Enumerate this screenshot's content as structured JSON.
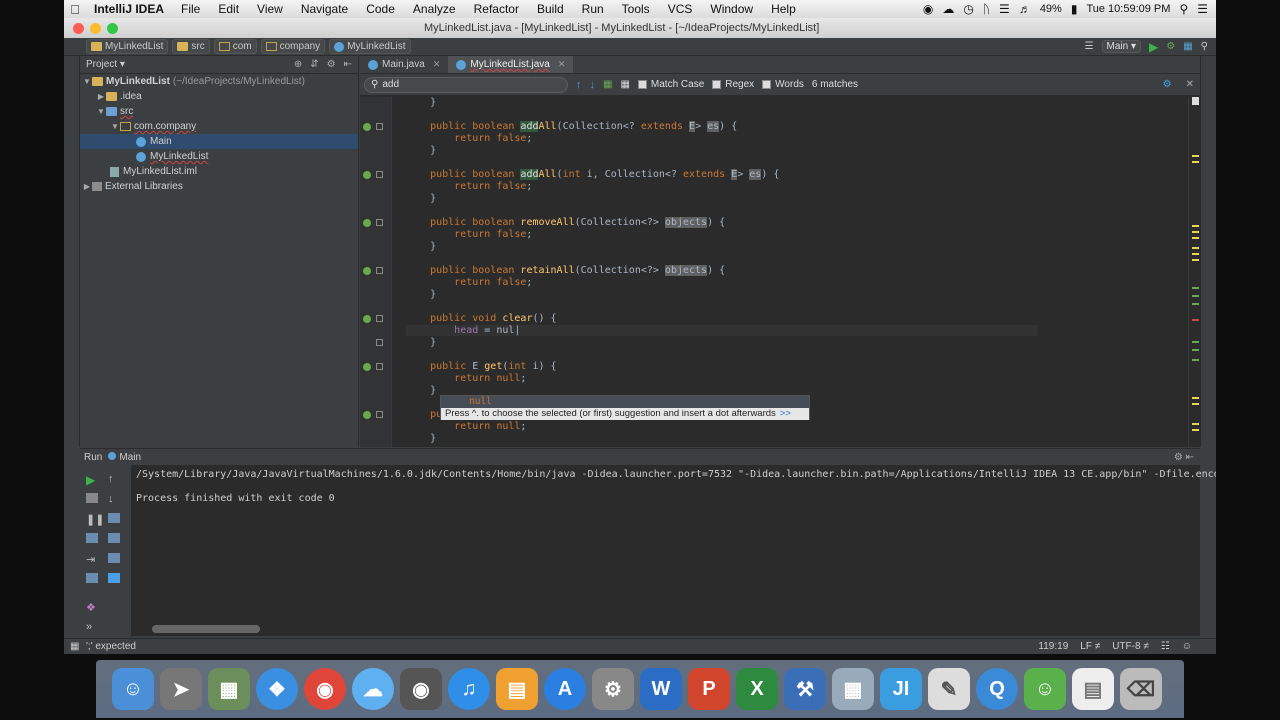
{
  "menubar": {
    "app": "IntelliJ IDEA",
    "items": [
      "File",
      "Edit",
      "View",
      "Navigate",
      "Code",
      "Analyze",
      "Refactor",
      "Build",
      "Run",
      "Tools",
      "VCS",
      "Window",
      "Help"
    ],
    "battery": "49%",
    "clock": "Tue 10:59:09 PM"
  },
  "window": {
    "title": "MyLinkedList.java - [MyLinkedList] - MyLinkedList - [~/IdeaProjects/MyLinkedList]"
  },
  "navbar": {
    "crumbs": [
      "MyLinkedList",
      "src",
      "com",
      "company",
      "MyLinkedList"
    ],
    "run_config": "Main"
  },
  "project": {
    "header": "Project",
    "tree": [
      {
        "label": "MyLinkedList",
        "muted": "(~/IdeaProjects/MyLinkedList)"
      },
      {
        "label": ".idea"
      },
      {
        "label": "src"
      },
      {
        "label": "com.company"
      },
      {
        "label": "Main"
      },
      {
        "label": "MyLinkedList"
      },
      {
        "label": "MyLinkedList.iml"
      },
      {
        "label": "External Libraries"
      }
    ]
  },
  "tabs": [
    "Main.java",
    "MyLinkedList.java"
  ],
  "search": {
    "query": "add",
    "match_case": "Match Case",
    "regex": "Regex",
    "words": "Words",
    "matches": "6 matches"
  },
  "completion": {
    "suggestion": "null",
    "hint": "Press ^. to choose the selected (or first) suggestion and insert a dot afterwards",
    "link": ">>"
  },
  "run": {
    "title": "Run",
    "config": "Main",
    "command": "/System/Library/Java/JavaVirtualMachines/1.6.0.jdk/Contents/Home/bin/java -Didea.launcher.port=7532 \"-Didea.launcher.bin.path=/Applications/IntelliJ IDEA 13 CE.app/bin\" -Dfile.encoding=UTF",
    "result": "Process finished with exit code 0"
  },
  "status": {
    "message": "';' expected",
    "position": "119:19",
    "line_sep": "LF ≠",
    "encoding": "UTF-8 ≠"
  }
}
